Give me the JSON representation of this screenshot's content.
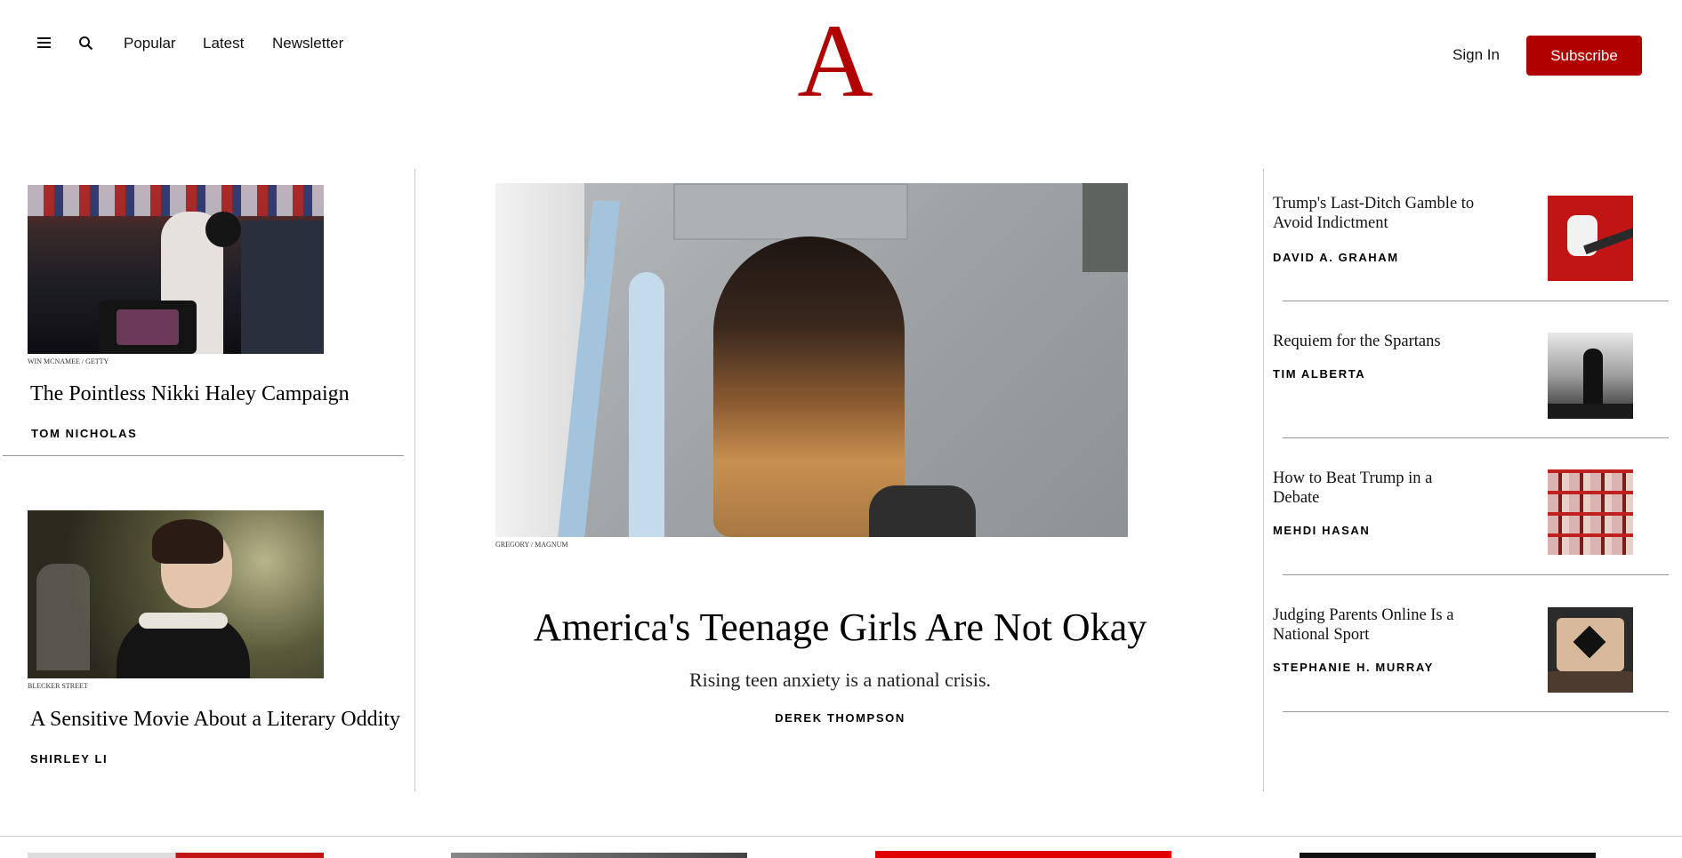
{
  "header": {
    "nav": [
      "Popular",
      "Latest",
      "Newsletter"
    ],
    "logo_letter": "A",
    "sign_in": "Sign In",
    "subscribe": "Subscribe",
    "brand_color": "#b00000"
  },
  "left_stories": [
    {
      "credit": "WIN MCNAMEE / GETTY",
      "title": "The Pointless Nikki Haley Campaign",
      "author": "TOM NICHOLAS"
    },
    {
      "credit": "BLECKER STREET",
      "title": "A Sensitive Movie About a Literary Oddity",
      "author": "SHIRLEY LI"
    }
  ],
  "feature": {
    "credit": "GREGORY / MAGNUM",
    "title": "America's Teenage Girls Are Not Okay",
    "dek": "Rising teen anxiety is a national crisis.",
    "author": "DEREK THOMPSON"
  },
  "right_stories": [
    {
      "title": "Trump's Last-Ditch Gamble to Avoid Indictment",
      "author": "DAVID A. GRAHAM"
    },
    {
      "title": "Requiem for the Spartans",
      "author": "TIM ALBERTA"
    },
    {
      "title": "How to Beat Trump in a Debate",
      "author": "MEHDI HASAN"
    },
    {
      "title": "Judging Parents Online Is a National Sport",
      "author": "STEPHANIE H. MURRAY"
    }
  ]
}
